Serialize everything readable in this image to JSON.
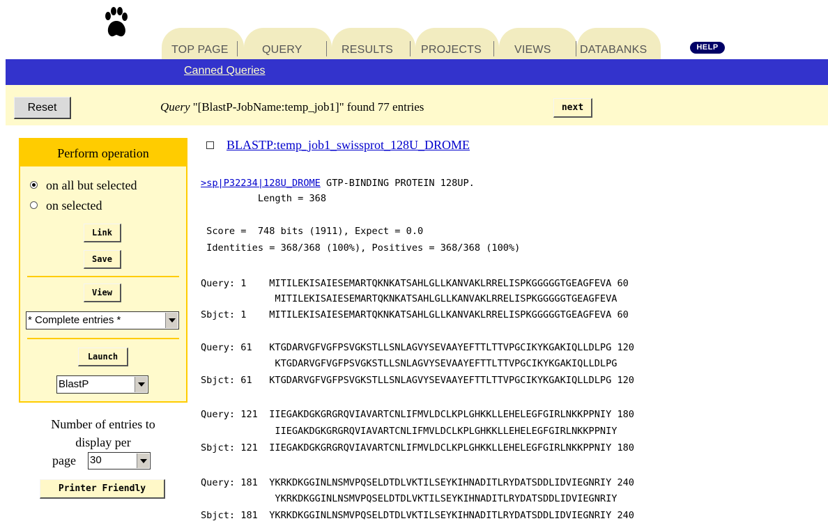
{
  "nav": {
    "tabs": [
      {
        "label": "TOP PAGE"
      },
      {
        "label": "QUERY"
      },
      {
        "label": "RESULTS"
      },
      {
        "label": "PROJECTS"
      },
      {
        "label": "VIEWS"
      },
      {
        "label": "DATABANKS"
      }
    ],
    "help_label": "HELP",
    "logo_icon": "paw-print-icon"
  },
  "subnav": {
    "canned_queries": "Canned Queries"
  },
  "querybar": {
    "reset_label": "Reset",
    "query_word": "Query",
    "query_text": "\"[BlastP-JobName:temp_job1]\" found 77 entries",
    "next_label": "next"
  },
  "operation_panel": {
    "title": "Perform operation",
    "radio_all_but_selected": "on all but selected",
    "radio_selected": "on selected",
    "selected_option": "on all but selected",
    "link_label": "Link",
    "save_label": "Save",
    "view_label": "View",
    "view_select_value": "* Complete entries *",
    "launch_label": "Launch",
    "launch_select_value": "BlastP"
  },
  "display_options": {
    "entries_line1": "Number of entries to",
    "entries_line2": "display per",
    "entries_line3": "page",
    "entries_value": "30",
    "printer_friendly_label": "Printer Friendly"
  },
  "result": {
    "title_link": "BLASTP:temp_job1_swissprot_128U_DROME",
    "seq_link": ">sp|P32234|128U_DROME",
    "seq_desc": " GTP-BINDING PROTEIN 128UP.",
    "length_line": "          Length = 368",
    "score_line": " Score =  748 bits (1911), Expect = 0.0",
    "identities_line": " Identities = 368/368 (100%), Positives = 368/368 (100%)",
    "alignment_blocks": [
      {
        "query": "Query: 1    MITILEKISAIESEMARTQKNKATSAHLGLLKANVAKLRRELISPKGGGGGTGEAGFEVA 60",
        "middle": "             MITILEKISAIESEMARTQKNKATSAHLGLLKANVAKLRRELISPKGGGGGTGEAGFEVA",
        "sbjct": "Sbjct: 1    MITILEKISAIESEMARTQKNKATSAHLGLLKANVAKLRRELISPKGGGGGTGEAGFEVA 60"
      },
      {
        "query": "Query: 61   KTGDARVGFVGFPSVGKSTLLSNLAGVYSEVAAYEFTTLTTVPGCIKYKGAKIQLLDLPG 120",
        "middle": "             KTGDARVGFVGFPSVGKSTLLSNLAGVYSEVAAYEFTTLTTVPGCIKYKGAKIQLLDLPG",
        "sbjct": "Sbjct: 61   KTGDARVGFVGFPSVGKSTLLSNLAGVYSEVAAYEFTTLTTVPGCIKYKGAKIQLLDLPG 120"
      },
      {
        "query": "Query: 121  IIEGAKDGKGRGRQVIAVARTCNLIFMVLDCLKPLGHKKLLEHELEGFGIRLNKKPPNIY 180",
        "middle": "             IIEGAKDGKGRGRQVIAVARTCNLIFMVLDCLKPLGHKKLLEHELEGFGIRLNKKPPNIY",
        "sbjct": "Sbjct: 121  IIEGAKDGKGRGRQVIAVARTCNLIFMVLDCLKPLGHKKLLEHELEGFGIRLNKKPPNIY 180"
      },
      {
        "query": "Query: 181  YKRKDKGGINLNSMVPQSELDTDLVKTILSEYKIHNADITLRYDATSDDLIDVIEGNRIY 240",
        "middle": "             YKRKDKGGINLNSMVPQSELDTDLVKTILSEYKIHNADITLRYDATSDDLIDVIEGNRIY",
        "sbjct": "Sbjct: 181  YKRKDKGGINLNSMVPQSELDTDLVKTILSEYKIHNADITLRYDATSDDLIDVIEGNRIY 240"
      }
    ]
  }
}
